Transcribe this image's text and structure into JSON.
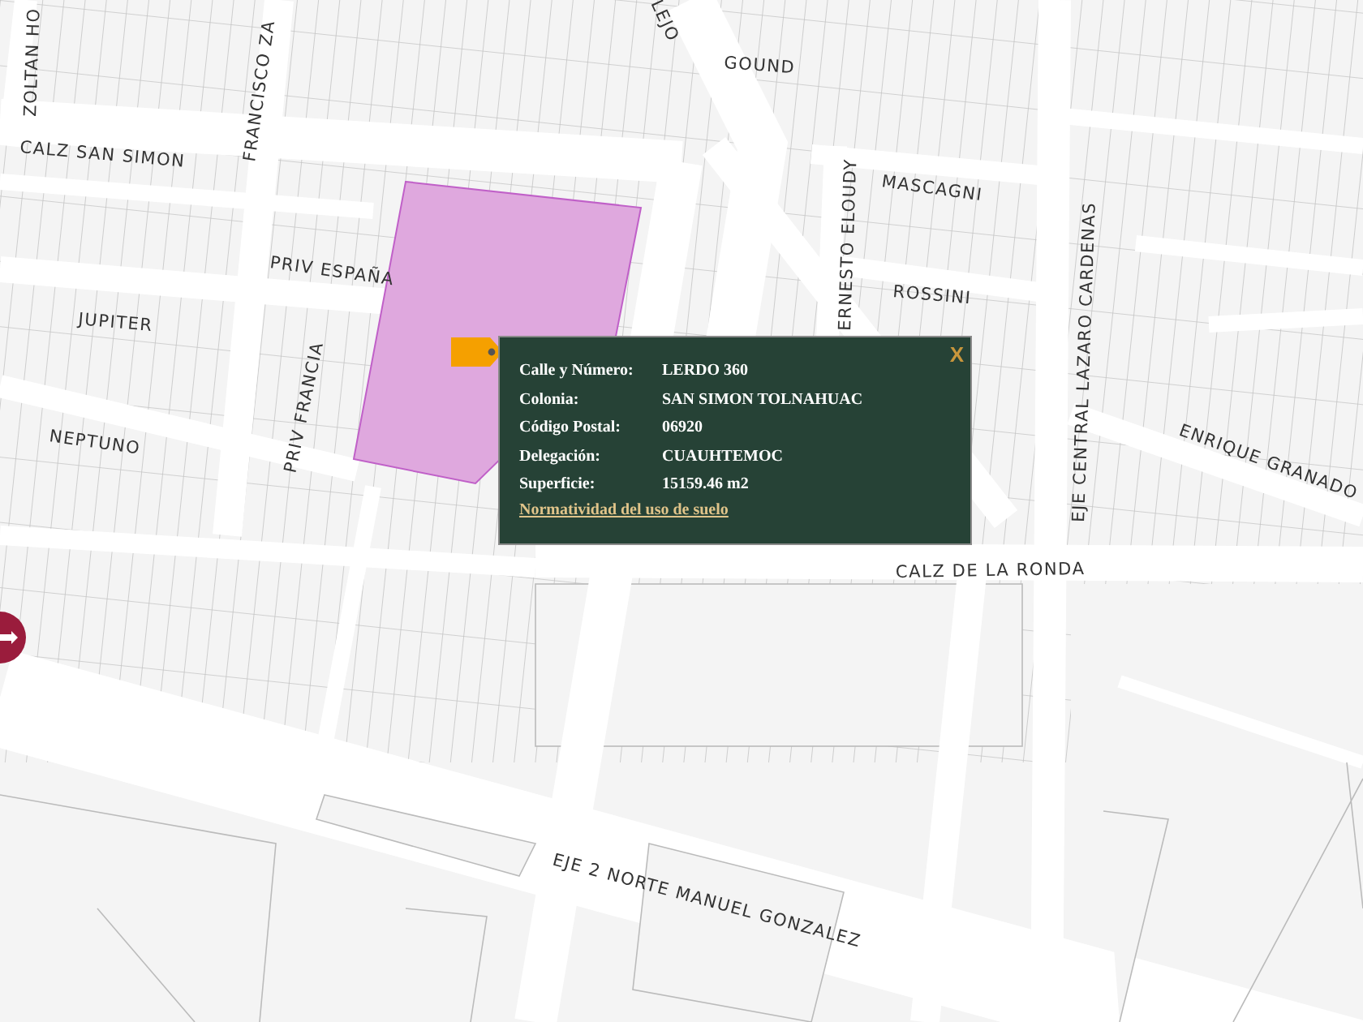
{
  "map": {
    "street_labels": [
      "ZOLTAN HO",
      "FRANCISCO ZA",
      "LEJO",
      "GOUND",
      "CALZ SAN SIMON",
      "MASCAGNI",
      "PRIV ESPAÑA",
      "ROSSINI",
      "JUPITER",
      "ERNESTO ELOUDY",
      "EJE CENTRAL LAZARO CARDENAS",
      "NEPTUNO",
      "PRIV FRANCIA",
      "ENRIQUE GRANADO",
      "CALZ DE LA RONDA",
      "EJE 2 NORTE MANUEL GONZALEZ"
    ]
  },
  "popup": {
    "close": "X",
    "fields": [
      {
        "label": "Calle y Número:",
        "value": "LERDO 360"
      },
      {
        "label": "Colonia:",
        "value": "SAN SIMON TOLNAHUAC"
      },
      {
        "label": "Código Postal:",
        "value": "06920"
      },
      {
        "label": "Delegación:",
        "value": "CUAUHTEMOC"
      },
      {
        "label": "Superficie:",
        "value": "15159.46 m2"
      }
    ],
    "link": "Normatividad del uso de suelo"
  }
}
